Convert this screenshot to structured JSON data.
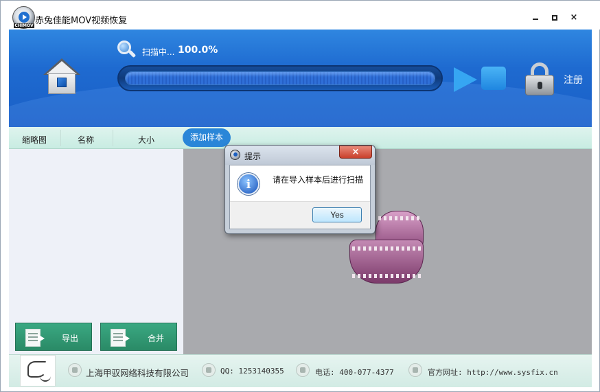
{
  "window": {
    "title": "赤兔佳能MOV视频恢复",
    "logo_tag": "CHIMOV",
    "controls": {
      "minimize": "",
      "maximize": "",
      "close": "×"
    }
  },
  "header": {
    "scan_status": "扫描中...",
    "scan_percent": "100.0%",
    "progress_fraction": 1.0,
    "register_label": "注册"
  },
  "columns": {
    "thumbnail": "缩略图",
    "name": "名称",
    "size": "大小",
    "add_sample": "添加样本"
  },
  "actions": {
    "export_label": "导出",
    "merge_label": "合并"
  },
  "footer": {
    "company": "上海甲驭网络科技有限公司",
    "qq": "QQ: 1253140355",
    "phone": "电话: 400-077-4377",
    "website": "官方网址: http://www.sysfix.cn"
  },
  "dialog": {
    "title": "提示",
    "close_label": "×",
    "info_glyph": "i",
    "message": "请在导入样本后进行扫描",
    "yes_label": "Yes"
  },
  "icons": {
    "app": "app-logo-icon",
    "home": "home-icon",
    "scan": "search-icon",
    "play": "play-icon",
    "stop": "stop-icon",
    "lock": "lock-icon",
    "export": "document-arrow-icon",
    "merge": "document-arrow-icon",
    "film": "film-reel-icon",
    "company": "building-icon",
    "qq": "qq-penguin-icon",
    "phone": "phone-icon",
    "website": "globe-icon",
    "dialog_info": "info-icon"
  },
  "colors": {
    "header_blue": "#1e6ad0",
    "accent_button": "#2a86d8",
    "action_green": "#2a8a66",
    "content_gray": "#a9aaae"
  }
}
